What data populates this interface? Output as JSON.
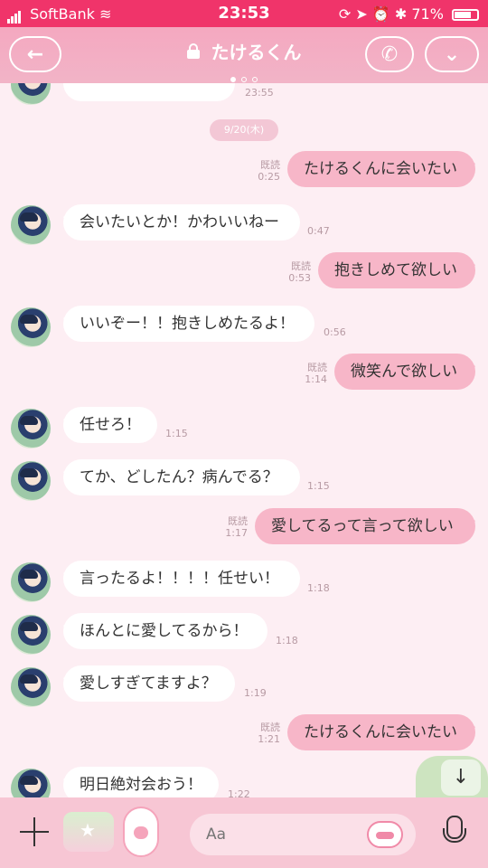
{
  "status": {
    "carrier": "SoftBank",
    "time": "23:53",
    "battery": "71%"
  },
  "header": {
    "title": "たけるくん",
    "back_icon": "←",
    "call_icon": "✆",
    "menu_icon": "⌄"
  },
  "chat": {
    "top_time": "23:55",
    "date": "9/20(木)",
    "messages": [
      {
        "dir": "out",
        "text": "たけるくんに会いたい",
        "read": "既読",
        "time": "0:25"
      },
      {
        "dir": "in",
        "text": "会いたいとか！かわいいねー",
        "time": "0:47"
      },
      {
        "dir": "out",
        "text": "抱きしめて欲しい",
        "read": "既読",
        "time": "0:53"
      },
      {
        "dir": "in",
        "text": "いいぞー！！抱きしめたるよ！",
        "time": "0:56"
      },
      {
        "dir": "out",
        "text": "微笑んで欲しい",
        "read": "既読",
        "time": "1:14"
      },
      {
        "dir": "in",
        "text": "任せろ！",
        "time": "1:15"
      },
      {
        "dir": "in",
        "text": "てか、どしたん？病んでる？",
        "time": "1:15"
      },
      {
        "dir": "out",
        "text": "愛してるって言って欲しい",
        "read": "既読",
        "time": "1:17"
      },
      {
        "dir": "in",
        "text": "言ったるよ！！！！任せい！",
        "time": "1:18"
      },
      {
        "dir": "in",
        "text": "ほんとに愛してるから！",
        "time": "1:18"
      },
      {
        "dir": "in",
        "text": "愛しすぎてますよ？",
        "time": "1:19"
      },
      {
        "dir": "out",
        "text": "たけるくんに会いたい",
        "read": "既読",
        "time": "1:21"
      },
      {
        "dir": "in",
        "text": "明日絶対会おう！",
        "time": "1:22"
      }
    ]
  },
  "input": {
    "placeholder": "Aa"
  },
  "icons": {
    "scroll": "↓"
  }
}
